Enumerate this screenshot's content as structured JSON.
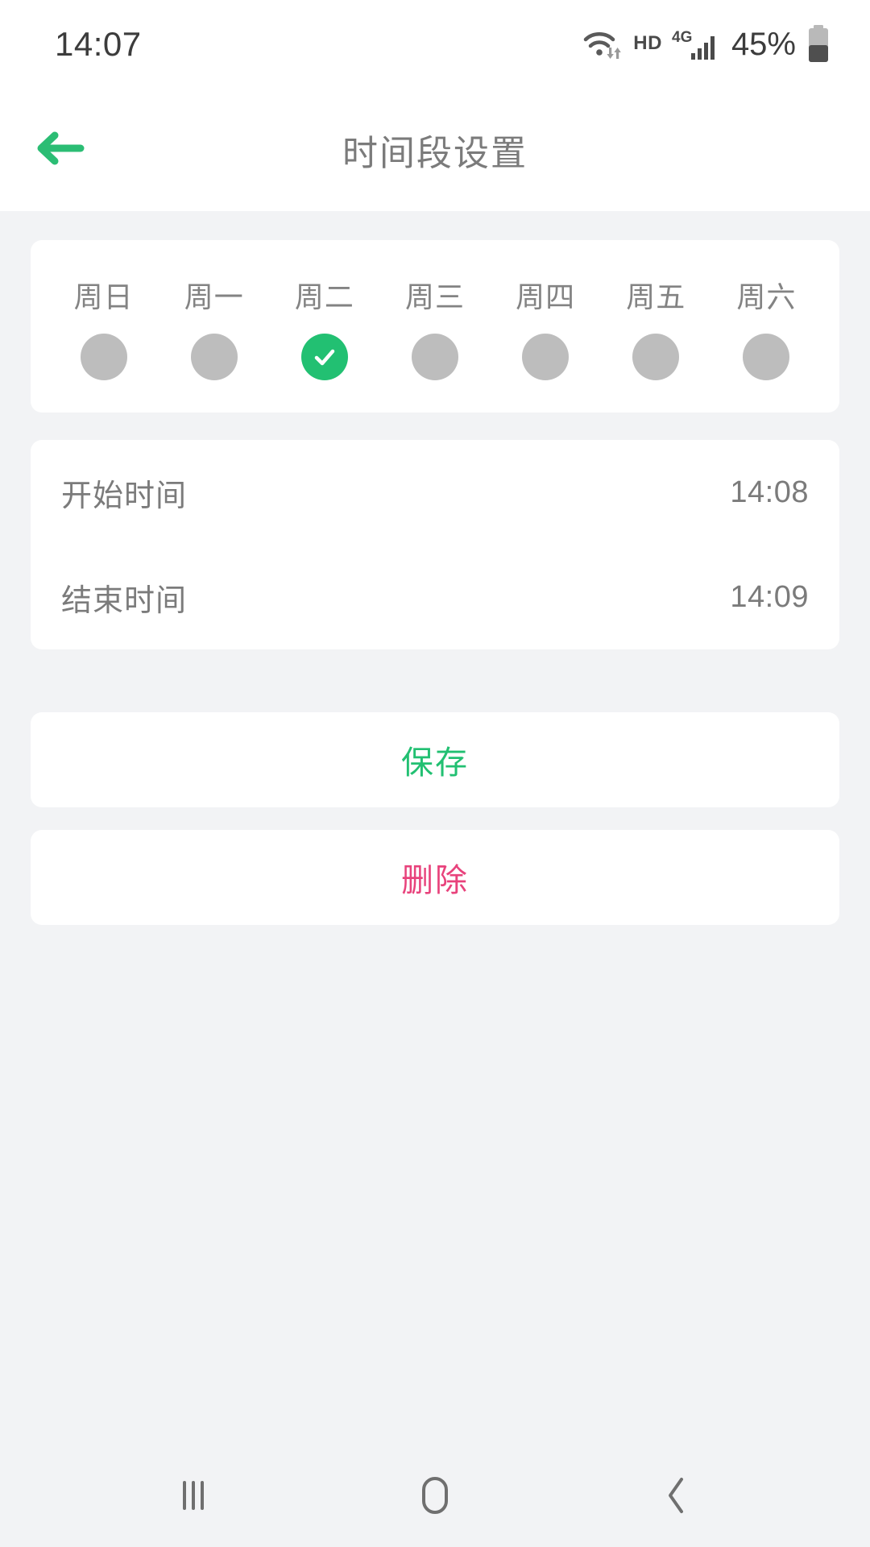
{
  "status_bar": {
    "clock": "14:07",
    "battery_percent": "45%",
    "network_label": "HD",
    "network_type": "4G",
    "icons": [
      "wifi-icon",
      "hd-icon",
      "signal-4g-icon",
      "battery-icon"
    ]
  },
  "app_bar": {
    "title": "时间段设置",
    "back_icon": "arrow-left-icon"
  },
  "days": {
    "items": [
      {
        "label": "周日",
        "selected": false
      },
      {
        "label": "周一",
        "selected": false
      },
      {
        "label": "周二",
        "selected": true
      },
      {
        "label": "周三",
        "selected": false
      },
      {
        "label": "周四",
        "selected": false
      },
      {
        "label": "周五",
        "selected": false
      },
      {
        "label": "周六",
        "selected": false
      }
    ]
  },
  "time_settings": {
    "start": {
      "label": "开始时间",
      "value": "14:08"
    },
    "end": {
      "label": "结束时间",
      "value": "14:09"
    }
  },
  "actions": {
    "save_label": "保存",
    "delete_label": "删除"
  },
  "nav_bar": {
    "recents_label": "recent-apps",
    "home_label": "home",
    "back_label": "back"
  },
  "colors": {
    "accent_green": "#22c072",
    "delete_pink": "#e8437c",
    "page_bg": "#f2f3f5",
    "card_bg": "#ffffff",
    "text_gray": "#7b7b7b",
    "dot_gray": "#bdbdbd"
  }
}
